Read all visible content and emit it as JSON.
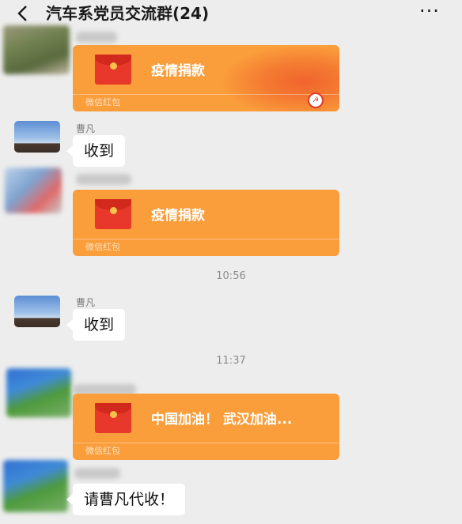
{
  "header": {
    "title": "汽车系党员交流群(24)",
    "back_icon": "chevron-left-icon",
    "more_icon": "ellipsis-icon",
    "more_glyph": "···"
  },
  "messages": {
    "rp1": {
      "title": "疫情捐款",
      "label": "微信红包"
    },
    "caofan1": {
      "name": "曹凡",
      "text": "收到"
    },
    "rp2": {
      "title": "疫情捐款",
      "label": "微信红包"
    },
    "time1": "10:56",
    "caofan2": {
      "name": "曹凡",
      "text": "收到"
    },
    "time2": "11:37",
    "rp3": {
      "title": "中国加油！ 武汉加油...",
      "label": "微信红包"
    },
    "last": {
      "text": "请曹凡代收！"
    }
  },
  "colors": {
    "background": "#ededed",
    "red_packet": "#fa9d3b",
    "envelope": "#e8382b",
    "bubble": "#ffffff"
  }
}
